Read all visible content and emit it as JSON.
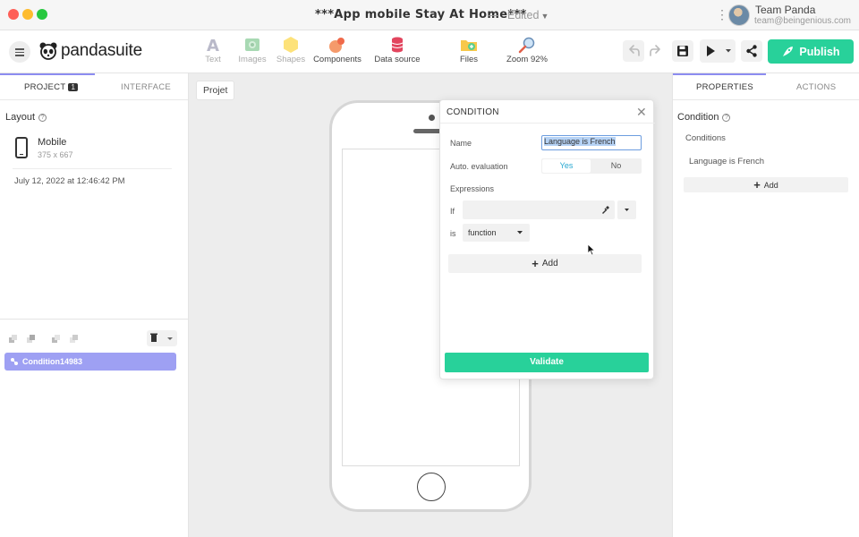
{
  "window": {
    "title": "***App mobile Stay At Home***",
    "status": "Edited",
    "separator": "—"
  },
  "user": {
    "name": "Team Panda",
    "email": "team@beingenious.com"
  },
  "toolbar": {
    "logo_text": "pandasuite",
    "tools": [
      {
        "label": "Text",
        "icon": "text-icon"
      },
      {
        "label": "Images",
        "icon": "image-icon"
      },
      {
        "label": "Shapes",
        "icon": "shapes-icon"
      },
      {
        "label": "Components",
        "icon": "components-icon"
      },
      {
        "label": "Data source",
        "icon": "database-icon"
      },
      {
        "label": "Files",
        "icon": "folder-icon"
      },
      {
        "label": "Zoom 92%",
        "icon": "zoom-icon"
      }
    ],
    "publish_label": "Publish"
  },
  "left_panel": {
    "tabs": [
      {
        "label": "PROJECT",
        "badge": "1"
      },
      {
        "label": "INTERFACE"
      }
    ],
    "layout_title": "Layout",
    "layout_item": {
      "name": "Mobile",
      "size": "375 x 667"
    },
    "date": "July 12, 2022 at 12:46:42 PM",
    "layer": "Condition14983"
  },
  "canvas": {
    "chip": "Projet"
  },
  "dialog": {
    "title": "CONDITION",
    "name_label": "Name",
    "name_value": "Language is French",
    "auto_label": "Auto. evaluation",
    "yes": "Yes",
    "no": "No",
    "expressions_label": "Expressions",
    "if_label": "If",
    "is_label": "is",
    "function_value": "function",
    "add_label": "Add",
    "validate_label": "Validate"
  },
  "right_panel": {
    "tabs": [
      "PROPERTIES",
      "ACTIONS"
    ],
    "condition_title": "Condition",
    "conditions_label": "Conditions",
    "condition_item": "Language is French",
    "add_label": "Add"
  },
  "colors": {
    "accent_green": "#28d19a",
    "tab_underline": "#8c8cf0",
    "layer_highlight": "#9ea0f3"
  }
}
